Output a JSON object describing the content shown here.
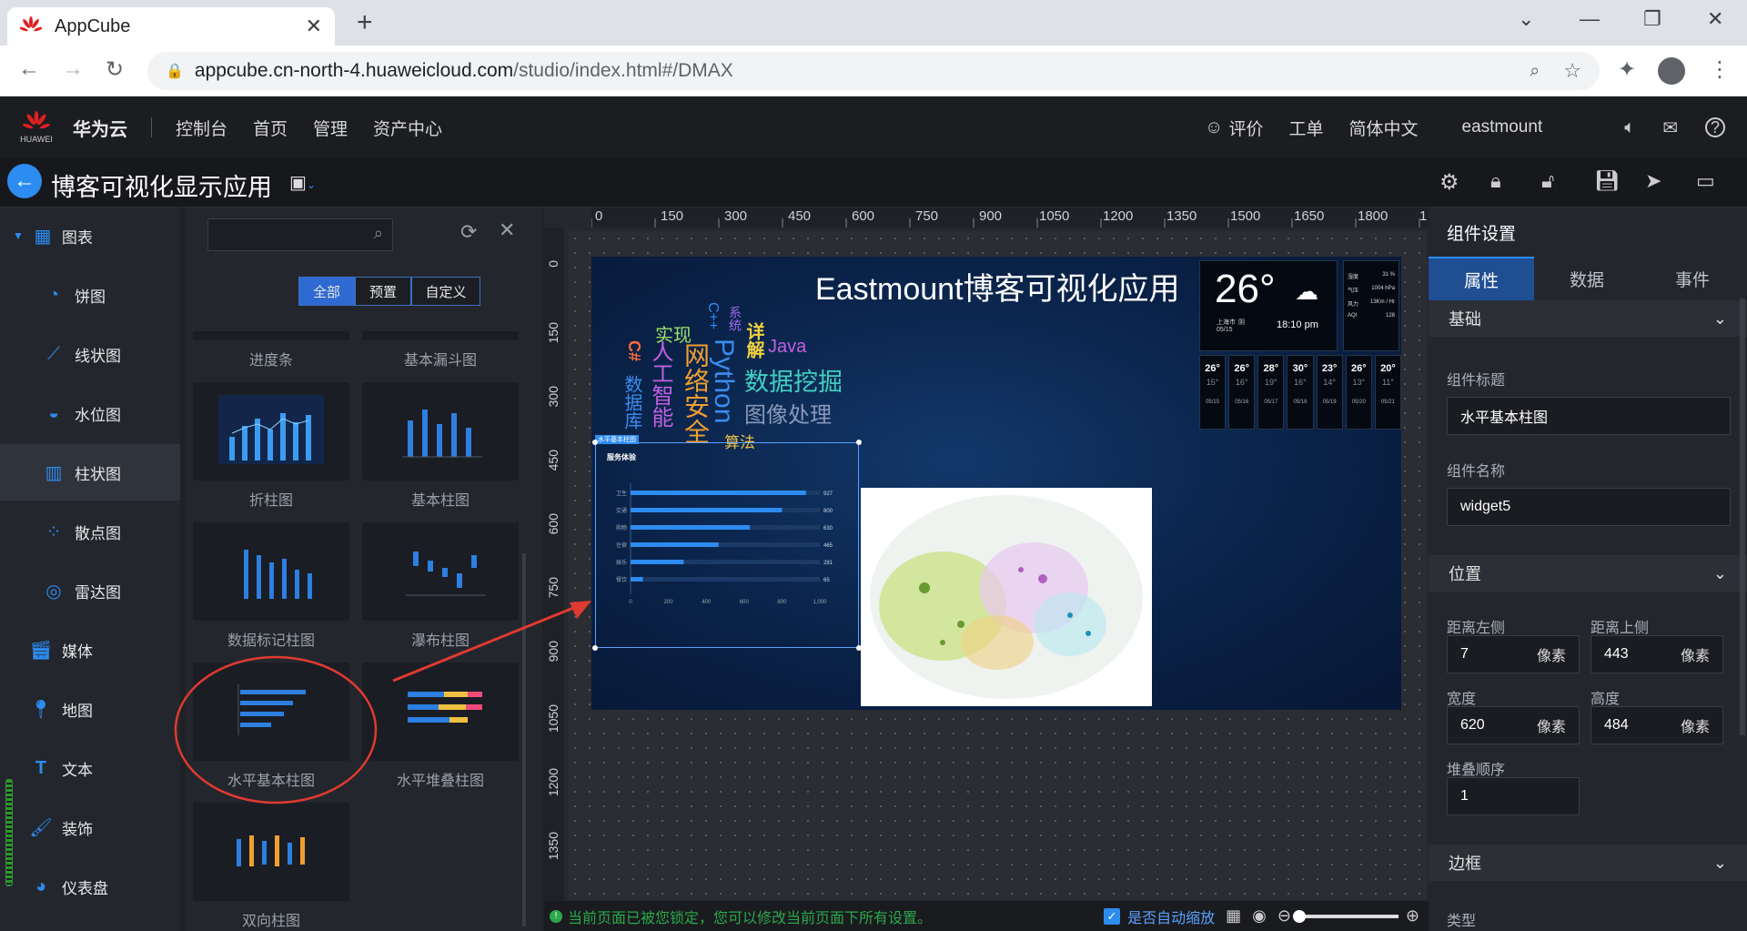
{
  "browser": {
    "tab_title": "AppCube",
    "url_host": "appcube.cn-north-4.huaweicloud.com",
    "url_path": "/studio/index.html#/DMAX"
  },
  "header": {
    "brand": "华为云",
    "logo_text": "HUAWEI",
    "nav": [
      "控制台",
      "首页",
      "管理",
      "资产中心"
    ],
    "rate": "评价",
    "ticket": "工单",
    "language": "简体中文",
    "user": "eastmount"
  },
  "app": {
    "title": "博客可视化显示应用"
  },
  "sidebar": {
    "category_chart": "图表",
    "items": [
      "饼图",
      "线状图",
      "水位图",
      "柱状图",
      "散点图",
      "雷达图"
    ],
    "categories": [
      "媒体",
      "地图",
      "文本",
      "装饰",
      "仪表盘"
    ]
  },
  "library": {
    "search_placeholder": "",
    "filters": [
      "全部",
      "预置",
      "自定义"
    ],
    "top_labels": [
      "进度条",
      "基本漏斗图"
    ],
    "widgets": [
      "折柱图",
      "基本柱图",
      "数据标记柱图",
      "瀑布柱图",
      "水平基本柱图",
      "水平堆叠柱图",
      "双向柱图"
    ]
  },
  "canvas": {
    "ruler_ticks": [
      "0",
      "150",
      "300",
      "450",
      "600",
      "750",
      "900",
      "1050",
      "1200",
      "1350",
      "1500",
      "1650",
      "1800",
      "1"
    ],
    "vruler_ticks": [
      "0",
      "150",
      "300",
      "450",
      "600",
      "750",
      "900",
      "1050",
      "1200",
      "1350"
    ],
    "dashboard_title": "Eastmount博客可视化应用",
    "weather": {
      "temp": "26°",
      "city": "上海市",
      "cond": "阴",
      "date": "05/15",
      "time": "18:10 pm",
      "stats": [
        [
          "湿度",
          "31 %"
        ],
        [
          "气压",
          "1004 hPa"
        ],
        [
          "风力",
          "13Km / Hr"
        ],
        [
          "AQI",
          "128"
        ]
      ],
      "forecast": [
        [
          "26°",
          "15°",
          "05/15"
        ],
        [
          "26°",
          "16°",
          "05/16"
        ],
        [
          "28°",
          "19°",
          "05/17"
        ],
        [
          "30°",
          "16°",
          "05/18"
        ],
        [
          "23°",
          "14°",
          "05/19"
        ],
        [
          "26°",
          "13°",
          "05/20"
        ],
        [
          "20°",
          "11°",
          "05/21"
        ]
      ]
    },
    "wordcloud": [
      {
        "text": "实现",
        "color": "#9be36a"
      },
      {
        "text": "系统",
        "color": "#a06cf0"
      },
      {
        "text": "C++",
        "color": "#2d8cf0"
      },
      {
        "text": "详解",
        "color": "#f0d040"
      },
      {
        "text": "Java",
        "color": "#c060e0"
      },
      {
        "text": "C#",
        "color": "#ff6a3c"
      },
      {
        "text": "人工智能",
        "color": "#c060e0"
      },
      {
        "text": "网络安全",
        "color": "#f0a030"
      },
      {
        "text": "Python",
        "color": "#3c8cf0"
      },
      {
        "text": "数据挖掘",
        "color": "#40d0c0"
      },
      {
        "text": "图像处理",
        "color": "#8898b8"
      },
      {
        "text": "数据库",
        "color": "#3c8cf0"
      },
      {
        "text": "算法",
        "color": "#f0c040"
      }
    ],
    "hbar_widget": {
      "tag": "水平基本柱图",
      "title": "服务体验",
      "chart_data": {
        "type": "bar",
        "orientation": "horizontal",
        "categories": [
          "卫生",
          "交通",
          "购物",
          "住宿",
          "娱乐",
          "餐饮"
        ],
        "values": [
          927,
          800,
          630,
          465,
          281,
          65
        ],
        "xlim": [
          0,
          1000
        ],
        "xticks": [
          "0",
          "200",
          "400",
          "600",
          "800",
          "1,000"
        ]
      }
    }
  },
  "panel": {
    "title": "组件设置",
    "tabs": [
      "属性",
      "数据",
      "事件"
    ],
    "section_basic": "基础",
    "label_title": "组件标题",
    "value_title": "水平基本柱图",
    "label_name": "组件名称",
    "value_name": "widget5",
    "section_position": "位置",
    "label_left": "距离左侧",
    "label_top": "距离上侧",
    "label_width": "宽度",
    "label_height": "高度",
    "left": "7",
    "top": "443",
    "width": "620",
    "height": "484",
    "unit": "像素",
    "label_z": "堆叠顺序",
    "z": "1",
    "section_border": "边框",
    "label_type": "类型"
  },
  "status": {
    "message": "当前页面已被您锁定，您可以修改当前页面下所有设置。",
    "autozoom": "是否自动缩放"
  }
}
